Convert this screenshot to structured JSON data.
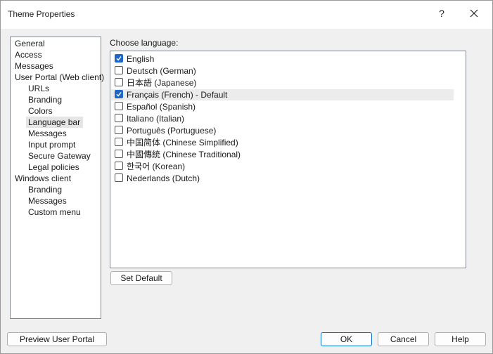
{
  "window": {
    "title": "Theme Properties",
    "help_glyph": "?"
  },
  "tree": {
    "items": [
      {
        "label": "General",
        "indent": 0,
        "selected": false
      },
      {
        "label": "Access",
        "indent": 0,
        "selected": false
      },
      {
        "label": "Messages",
        "indent": 0,
        "selected": false
      },
      {
        "label": "User Portal (Web client)",
        "indent": 0,
        "selected": false
      },
      {
        "label": "URLs",
        "indent": 1,
        "selected": false
      },
      {
        "label": "Branding",
        "indent": 1,
        "selected": false
      },
      {
        "label": "Colors",
        "indent": 1,
        "selected": false
      },
      {
        "label": "Language bar",
        "indent": 1,
        "selected": true
      },
      {
        "label": "Messages",
        "indent": 1,
        "selected": false
      },
      {
        "label": "Input prompt",
        "indent": 1,
        "selected": false
      },
      {
        "label": "Secure Gateway",
        "indent": 1,
        "selected": false
      },
      {
        "label": "Legal policies",
        "indent": 1,
        "selected": false
      },
      {
        "label": "Windows client",
        "indent": 0,
        "selected": false
      },
      {
        "label": "Branding",
        "indent": 1,
        "selected": false
      },
      {
        "label": "Messages",
        "indent": 1,
        "selected": false
      },
      {
        "label": "Custom menu",
        "indent": 1,
        "selected": false
      }
    ]
  },
  "language": {
    "choose_label": "Choose language:",
    "items": [
      {
        "label": "English",
        "checked": true,
        "highlight": false
      },
      {
        "label": "Deutsch (German)",
        "checked": false,
        "highlight": false
      },
      {
        "label": "日本語 (Japanese)",
        "checked": false,
        "highlight": false
      },
      {
        "label": "Français (French) - Default",
        "checked": true,
        "highlight": true
      },
      {
        "label": "Español (Spanish)",
        "checked": false,
        "highlight": false
      },
      {
        "label": "Italiano (Italian)",
        "checked": false,
        "highlight": false
      },
      {
        "label": "Português (Portuguese)",
        "checked": false,
        "highlight": false
      },
      {
        "label": "中国简体 (Chinese Simplified)",
        "checked": false,
        "highlight": false
      },
      {
        "label": "中國傳統 (Chinese Traditional)",
        "checked": false,
        "highlight": false
      },
      {
        "label": "한국어 (Korean)",
        "checked": false,
        "highlight": false
      },
      {
        "label": "Nederlands (Dutch)",
        "checked": false,
        "highlight": false
      }
    ],
    "set_default_label": "Set Default"
  },
  "footer": {
    "preview_label": "Preview User Portal",
    "ok_label": "OK",
    "cancel_label": "Cancel",
    "help_label": "Help"
  },
  "colors": {
    "checkbox_checked": "#1e67c6",
    "selection": "#e5e5e5",
    "default_button_border": "#0b6fd0"
  }
}
